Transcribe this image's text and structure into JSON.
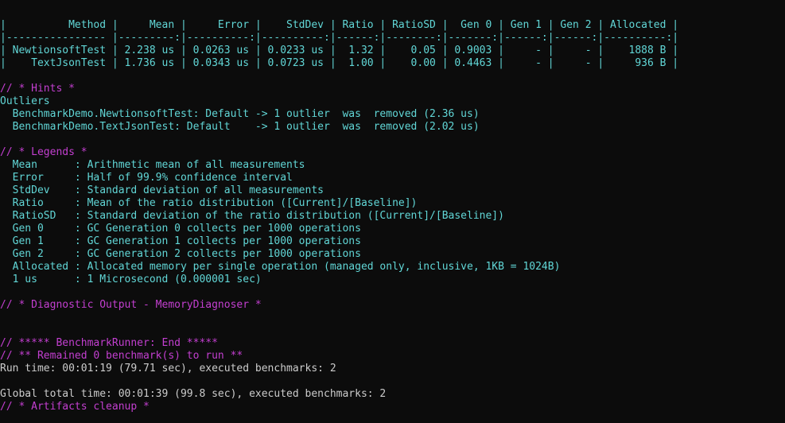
{
  "colors": {
    "background": "#0c0c0c",
    "table": "#61d6d6",
    "text": "#cccccc",
    "heading": "#c33fd0"
  },
  "table": {
    "header": "|          Method |     Mean |     Error |    StdDev | Ratio | RatioSD |  Gen 0 | Gen 1 | Gen 2 | Allocated |",
    "separator": "|---------------- |---------:|----------:|----------:|------:|--------:|-------:|------:|------:|----------:|",
    "rows": [
      "| NewtionsoftTest | 2.238 us | 0.0263 us | 0.0233 us |  1.32 |    0.05 | 0.9003 |     - |     - |    1888 B |",
      "|    TextJsonTest | 1.736 us | 0.0343 us | 0.0723 us |  1.00 |    0.00 | 0.4463 |     - |     - |     936 B |"
    ]
  },
  "hints": {
    "heading": "// * Hints *",
    "label": "Outliers",
    "items": [
      "  BenchmarkDemo.NewtionsoftTest: Default -> 1 outlier  was  removed (2.36 us)",
      "  BenchmarkDemo.TextJsonTest: Default    -> 1 outlier  was  removed (2.02 us)"
    ]
  },
  "legends": {
    "heading": "// * Legends *",
    "items": [
      "  Mean      : Arithmetic mean of all measurements",
      "  Error     : Half of 99.9% confidence interval",
      "  StdDev    : Standard deviation of all measurements",
      "  Ratio     : Mean of the ratio distribution ([Current]/[Baseline])",
      "  RatioSD   : Standard deviation of the ratio distribution ([Current]/[Baseline])",
      "  Gen 0     : GC Generation 0 collects per 1000 operations",
      "  Gen 1     : GC Generation 1 collects per 1000 operations",
      "  Gen 2     : GC Generation 2 collects per 1000 operations",
      "  Allocated : Allocated memory per single operation (managed only, inclusive, 1KB = 1024B)",
      "  1 us      : 1 Microsecond (0.000001 sec)"
    ]
  },
  "diagnostic": {
    "heading": "// * Diagnostic Output - MemoryDiagnoser *"
  },
  "runner": {
    "end": "// ***** BenchmarkRunner: End *****",
    "remained": "// ** Remained 0 benchmark(s) to run **",
    "run_time": "Run time: 00:01:19 (79.71 sec), executed benchmarks: 2",
    "global_time": "Global total time: 00:01:39 (99.8 sec), executed benchmarks: 2",
    "cleanup": "// * Artifacts cleanup *"
  }
}
